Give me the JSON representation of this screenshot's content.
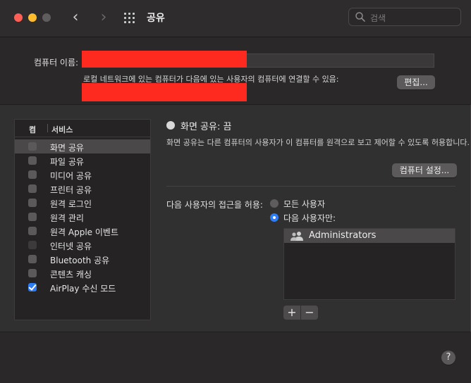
{
  "window": {
    "title": "공유",
    "search_placeholder": "검색",
    "back_glyph": "‹",
    "forward_glyph": "›"
  },
  "computer_name": {
    "label": "컴퓨터 이름:",
    "value": "",
    "description": "로컬 네트워크에 있는 컴퓨터가 다음에 있는 사용자의 컴퓨터에 연결할 수 있음:",
    "edit_button": "편집..."
  },
  "services": {
    "header_on": "켬",
    "header_service": "서비스",
    "items": [
      {
        "label": "화면 공유",
        "checked": false,
        "selected": true
      },
      {
        "label": "파일 공유",
        "checked": false,
        "selected": false
      },
      {
        "label": "미디어 공유",
        "checked": false,
        "selected": false
      },
      {
        "label": "프린터 공유",
        "checked": false,
        "selected": false
      },
      {
        "label": "원격 로그인",
        "checked": false,
        "selected": false
      },
      {
        "label": "원격 관리",
        "checked": false,
        "selected": false
      },
      {
        "label": "원격 Apple 이벤트",
        "checked": false,
        "selected": false
      },
      {
        "label": "인터넷 공유",
        "checked": false,
        "selected": false
      },
      {
        "label": "Bluetooth 공유",
        "checked": false,
        "selected": false
      },
      {
        "label": "콘텐츠 캐싱",
        "checked": false,
        "selected": false
      },
      {
        "label": "AirPlay 수신 모드",
        "checked": true,
        "selected": false
      }
    ]
  },
  "detail": {
    "status": "화면 공유: 끔",
    "info": "화면 공유는 다른 컴퓨터의 사용자가 이 컴퓨터를 원격으로 보고 제어할 수 있도록 허용합니다.",
    "computer_settings_button": "컴퓨터 설정...",
    "access_label": "다음 사용자의 접근을 허용:",
    "option_all": "모든 사용자",
    "option_only": "다음 사용자만:",
    "selected_option": "option_only",
    "users": [
      "Administrators"
    ],
    "add_glyph": "+",
    "remove_glyph": "−"
  },
  "help_glyph": "?",
  "colors": {
    "accent": "#2e7cf6",
    "redaction": "#ff2a1f",
    "close": "#ff5f57",
    "minimize": "#febc2e"
  }
}
